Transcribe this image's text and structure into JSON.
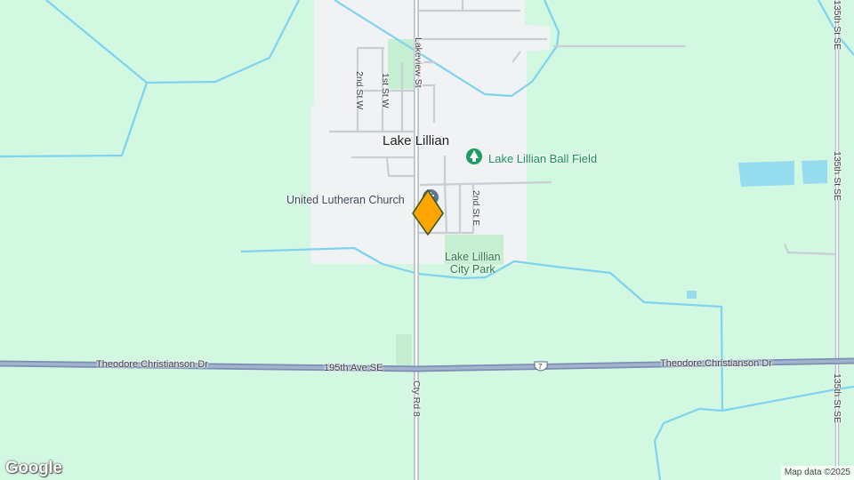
{
  "map": {
    "town_label": "Lake Lillian",
    "pois": {
      "church": "United Lutheran Church",
      "ball_field": "Lake Lillian Ball Field",
      "park_line1": "Lake Lillian",
      "park_line2": "City Park"
    },
    "roads": {
      "lakeview": "Lakeview St",
      "second_w": "2nd St W",
      "first_w": "1st St W",
      "second_e": "2nd St E",
      "theodore_left": "Theodore Christianson Dr",
      "ave_195": "195th Ave SE",
      "theodore_right": "Theodore Christianson Dr",
      "cty_rd": "Cty Rd 8",
      "st_135_top": "135th St SE",
      "st_135_bottom": "135th St SE",
      "route_shield": "7"
    },
    "attribution": "Map data ©2025",
    "logo": "Google"
  },
  "colors": {
    "land": "#d3f8e2",
    "town": "#f2f2f4",
    "water": "#7dd3ef",
    "highway": "#8da2c0",
    "marker": "#ffa500"
  },
  "icons": [
    "tree-icon",
    "church-icon",
    "location-marker-icon"
  ]
}
